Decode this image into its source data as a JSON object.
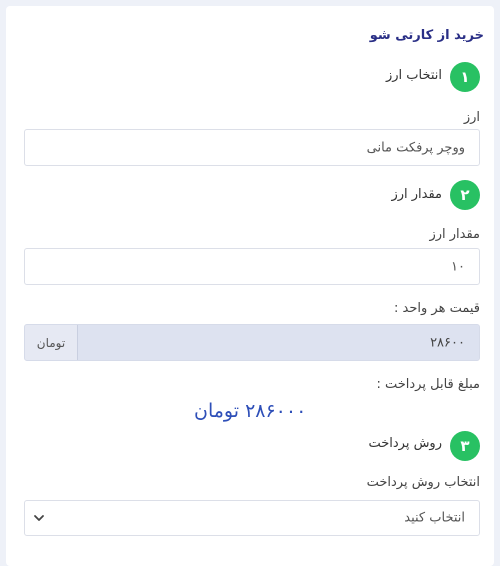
{
  "title": "خرید از کارتی شو",
  "steps": [
    {
      "number": "۱",
      "label": "انتخاب ارز"
    },
    {
      "number": "۲",
      "label": "مقدار ارز"
    },
    {
      "number": "۳",
      "label": "روش پرداخت"
    }
  ],
  "currency": {
    "label": "ارز",
    "value": "ووچر پرفکت مانی"
  },
  "amount": {
    "label": "مقدار ارز",
    "value": "۱۰"
  },
  "unit_price": {
    "label": "قیمت هر واحد :",
    "value": "۲۸۶۰۰",
    "unit": "تومان"
  },
  "payable": {
    "label": "مبلغ قابل پرداخت :",
    "value": "۲۸۶۰۰۰ تومان"
  },
  "payment": {
    "label": "انتخاب روش پرداخت",
    "selected": "انتخاب کنید"
  },
  "icons": {
    "dropdown": "chevron-down-icon"
  },
  "colors": {
    "accent": "#28c163",
    "title": "#2a2f86",
    "total": "#2e4fb8",
    "readonly_bg": "#dde2f0"
  }
}
